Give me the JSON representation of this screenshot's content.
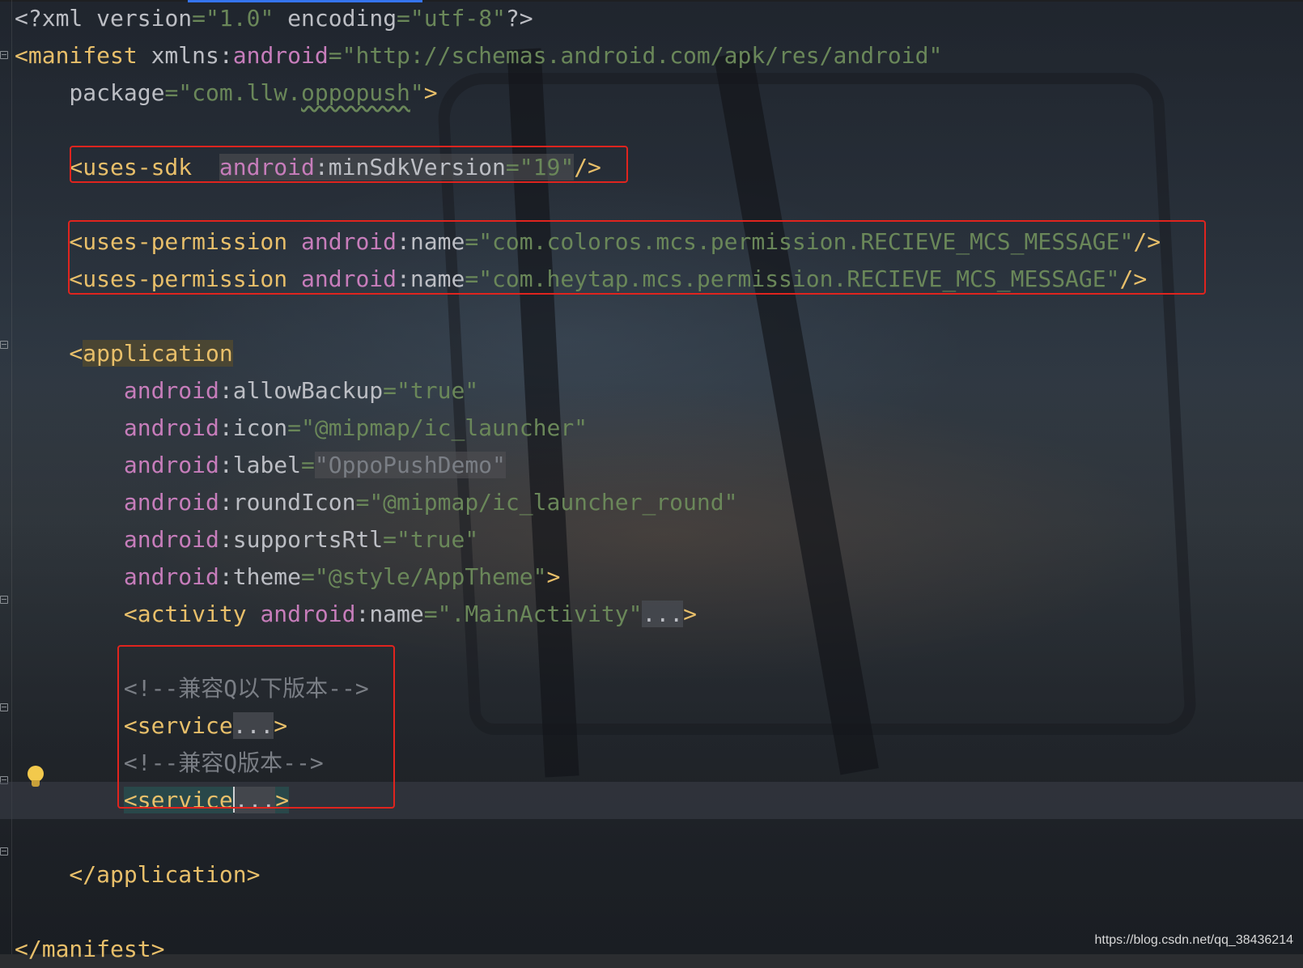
{
  "editor": {
    "lines": [
      {
        "segments": [
          {
            "t": "<?xml ",
            "c": "plain"
          },
          {
            "t": "version",
            "c": "attr"
          },
          {
            "t": "=",
            "c": "eq"
          },
          {
            "t": "\"1.0\"",
            "c": "str"
          },
          {
            "t": " encoding",
            "c": "attr"
          },
          {
            "t": "=",
            "c": "eq"
          },
          {
            "t": "\"utf-8\"",
            "c": "str"
          },
          {
            "t": "?>",
            "c": "plain"
          }
        ]
      },
      {
        "segments": [
          {
            "t": "<manifest ",
            "c": "tag"
          },
          {
            "t": "xmlns",
            "c": "attr"
          },
          {
            "t": ":",
            "c": "plain"
          },
          {
            "t": "android",
            "c": "attr-ns"
          },
          {
            "t": "=",
            "c": "eq"
          },
          {
            "t": "\"http://schemas.android.com/apk/res/android\"",
            "c": "str"
          }
        ]
      },
      {
        "segments": [
          {
            "t": "    package",
            "c": "attr"
          },
          {
            "t": "=",
            "c": "eq"
          },
          {
            "t": "\"com.llw.",
            "c": "str"
          },
          {
            "t": "oppopush",
            "c": "str typo"
          },
          {
            "t": "\"",
            "c": "str"
          },
          {
            "t": ">",
            "c": "tag"
          }
        ]
      },
      {
        "segments": [
          {
            "t": "",
            "c": "plain"
          }
        ]
      },
      {
        "segments": [
          {
            "t": "    <uses-sdk  ",
            "c": "tag"
          },
          {
            "t": "android",
            "c": "attr-ns hl-attr"
          },
          {
            "t": ":",
            "c": "plain hl-attr"
          },
          {
            "t": "minSdkVersion",
            "c": "attr hl-attr"
          },
          {
            "t": "=",
            "c": "eq hl-attr"
          },
          {
            "t": "\"19\"",
            "c": "str hl-attr"
          },
          {
            "t": "/>",
            "c": "tag"
          }
        ]
      },
      {
        "segments": [
          {
            "t": "",
            "c": "plain"
          }
        ]
      },
      {
        "segments": [
          {
            "t": "    <uses-permission ",
            "c": "tag"
          },
          {
            "t": "android",
            "c": "attr-ns"
          },
          {
            "t": ":",
            "c": "plain"
          },
          {
            "t": "name",
            "c": "attr"
          },
          {
            "t": "=",
            "c": "eq"
          },
          {
            "t": "\"com.coloros.mcs.permission.RECIEVE_MCS_MESSAGE\"",
            "c": "str"
          },
          {
            "t": "/>",
            "c": "tag"
          }
        ]
      },
      {
        "segments": [
          {
            "t": "    <uses-permission ",
            "c": "tag"
          },
          {
            "t": "android",
            "c": "attr-ns"
          },
          {
            "t": ":",
            "c": "plain"
          },
          {
            "t": "name",
            "c": "attr"
          },
          {
            "t": "=",
            "c": "eq"
          },
          {
            "t": "\"com.heytap.mcs.permission.RECIEVE_MCS_MESSAGE\"",
            "c": "str"
          },
          {
            "t": "/>",
            "c": "tag"
          }
        ]
      },
      {
        "segments": [
          {
            "t": "",
            "c": "plain"
          }
        ]
      },
      {
        "segments": [
          {
            "t": "    <",
            "c": "tag"
          },
          {
            "t": "application",
            "c": "tag hl-tag"
          }
        ]
      },
      {
        "segments": [
          {
            "t": "        android",
            "c": "attr-ns"
          },
          {
            "t": ":",
            "c": "plain"
          },
          {
            "t": "allowBackup",
            "c": "attr"
          },
          {
            "t": "=",
            "c": "eq"
          },
          {
            "t": "\"true\"",
            "c": "str"
          }
        ]
      },
      {
        "segments": [
          {
            "t": "        android",
            "c": "attr-ns"
          },
          {
            "t": ":",
            "c": "plain"
          },
          {
            "t": "icon",
            "c": "attr"
          },
          {
            "t": "=",
            "c": "eq"
          },
          {
            "t": "\"@mipmap/ic_launcher\"",
            "c": "str"
          }
        ]
      },
      {
        "segments": [
          {
            "t": "        android",
            "c": "attr-ns"
          },
          {
            "t": ":",
            "c": "plain"
          },
          {
            "t": "label",
            "c": "attr"
          },
          {
            "t": "=",
            "c": "eq"
          },
          {
            "t": "\"OppoPushDemo\"",
            "c": "cmt hl-attr"
          }
        ]
      },
      {
        "segments": [
          {
            "t": "        android",
            "c": "attr-ns"
          },
          {
            "t": ":",
            "c": "plain"
          },
          {
            "t": "roundIcon",
            "c": "attr"
          },
          {
            "t": "=",
            "c": "eq"
          },
          {
            "t": "\"@mipmap/ic_launcher_round\"",
            "c": "str"
          }
        ]
      },
      {
        "segments": [
          {
            "t": "        android",
            "c": "attr-ns"
          },
          {
            "t": ":",
            "c": "plain"
          },
          {
            "t": "supportsRtl",
            "c": "attr"
          },
          {
            "t": "=",
            "c": "eq"
          },
          {
            "t": "\"true\"",
            "c": "str"
          }
        ]
      },
      {
        "segments": [
          {
            "t": "        android",
            "c": "attr-ns"
          },
          {
            "t": ":",
            "c": "plain"
          },
          {
            "t": "theme",
            "c": "attr"
          },
          {
            "t": "=",
            "c": "eq"
          },
          {
            "t": "\"@style/AppTheme\"",
            "c": "str"
          },
          {
            "t": ">",
            "c": "tag"
          }
        ]
      },
      {
        "segments": [
          {
            "t": "        <activity ",
            "c": "tag"
          },
          {
            "t": "android",
            "c": "attr-ns"
          },
          {
            "t": ":",
            "c": "plain"
          },
          {
            "t": "name",
            "c": "attr"
          },
          {
            "t": "=",
            "c": "eq"
          },
          {
            "t": "\".MainActivity\"",
            "c": "str"
          },
          {
            "t": "...",
            "c": "fold-dots"
          },
          {
            "t": ">",
            "c": "tag"
          }
        ]
      },
      {
        "segments": [
          {
            "t": "",
            "c": "plain"
          }
        ]
      },
      {
        "segments": [
          {
            "t": "        <!--兼容Q以下版本-->",
            "c": "cmt"
          }
        ]
      },
      {
        "segments": [
          {
            "t": "        <service",
            "c": "tag"
          },
          {
            "t": "...",
            "c": "fold-dots"
          },
          {
            "t": ">",
            "c": "tag"
          }
        ]
      },
      {
        "segments": [
          {
            "t": "        <!--兼容Q版本-->",
            "c": "cmt"
          }
        ]
      },
      {
        "segments": [
          {
            "t": "        ",
            "c": "plain"
          },
          {
            "t": "<service",
            "c": "tag hl-svc"
          },
          {
            "t": "|",
            "c": "caret"
          },
          {
            "t": "...",
            "c": "fold-dots"
          },
          {
            "t": ">",
            "c": "tag hl-svc"
          }
        ],
        "caret_line": true
      },
      {
        "segments": [
          {
            "t": "",
            "c": "plain"
          }
        ]
      },
      {
        "segments": [
          {
            "t": "    </application>",
            "c": "tag"
          }
        ]
      },
      {
        "segments": [
          {
            "t": "",
            "c": "plain"
          }
        ]
      },
      {
        "segments": [
          {
            "t": "</manifest>",
            "c": "tag"
          }
        ]
      }
    ]
  },
  "watermark": "https://blog.csdn.net/qq_38436214",
  "icons": {
    "intention": "lightbulb-icon",
    "fold": "fold-marker-icon"
  },
  "colors": {
    "tag": "#e8bf6a",
    "namespace": "#c77dbb",
    "string": "#6a8759",
    "comment": "#7a7e85",
    "annotation_box": "#e0241e"
  }
}
